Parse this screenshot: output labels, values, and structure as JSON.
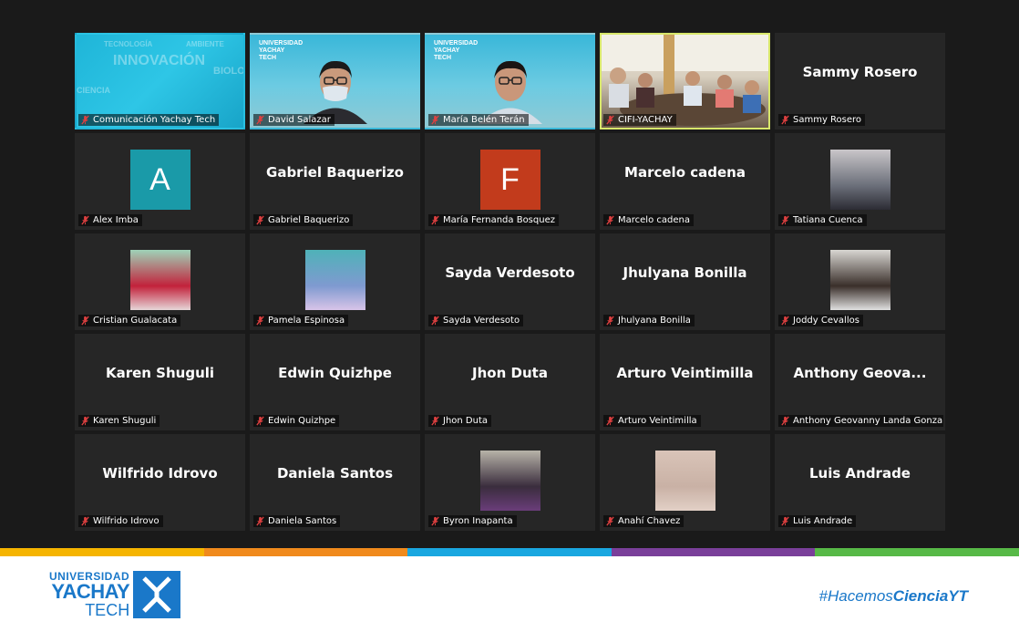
{
  "participants": [
    {
      "name": "Comunicación Yachay Tech",
      "display": "",
      "kind": "video-cyan",
      "overlay": [
        "INNOVACIÓN",
        "TECNOLOGÍA",
        "AMBIENTE",
        "CIENCIA",
        "BIOLO"
      ]
    },
    {
      "name": "David Salazar",
      "display": "",
      "kind": "video-building",
      "brand": "UNIVERSIDAD YACHAY TECH"
    },
    {
      "name": "María Belén Terán",
      "display": "",
      "kind": "video-building",
      "brand": "UNIVERSIDAD YACHAY TECH"
    },
    {
      "name": "CIFI-YACHAY",
      "display": "",
      "kind": "video-room",
      "active": true
    },
    {
      "name": "Sammy Rosero",
      "display": "Sammy Rosero",
      "kind": "name"
    },
    {
      "name": "Alex Imba",
      "display": "",
      "kind": "letter",
      "letter": "A",
      "color": "#1a9aa8"
    },
    {
      "name": "Gabriel Baquerizo",
      "display": "Gabriel Baquerizo",
      "kind": "name"
    },
    {
      "name": "María Fernanda Bosquez",
      "display": "",
      "kind": "letter",
      "letter": "F",
      "color": "#c23b1c"
    },
    {
      "name": "Marcelo cadena",
      "display": "Marcelo cadena",
      "kind": "name"
    },
    {
      "name": "Tatiana Cuenca",
      "display": "",
      "kind": "photo",
      "palette": [
        "#c9c6c9",
        "#6b6f7a",
        "#2c2c34"
      ]
    },
    {
      "name": "Cristian Gualacata",
      "display": "",
      "kind": "photo",
      "palette": [
        "#9fd3b8",
        "#c2223b",
        "#e6d6d8"
      ]
    },
    {
      "name": "Pamela Espinosa",
      "display": "",
      "kind": "photo",
      "palette": [
        "#4fb2b8",
        "#7f9ad0",
        "#d8c4e8"
      ]
    },
    {
      "name": "Sayda Verdesoto",
      "display": "Sayda Verdesoto",
      "kind": "name"
    },
    {
      "name": "Jhulyana Bonilla",
      "display": "Jhulyana Bonilla",
      "kind": "name"
    },
    {
      "name": "Joddy Cevallos",
      "display": "",
      "kind": "photo",
      "palette": [
        "#d8d6d2",
        "#3a2f2a",
        "#e0e0e0"
      ]
    },
    {
      "name": "Karen Shuguli",
      "display": "Karen Shuguli",
      "kind": "name"
    },
    {
      "name": "Edwin Quizhpe",
      "display": "Edwin Quizhpe",
      "kind": "name"
    },
    {
      "name": "Jhon Duta",
      "display": "Jhon Duta",
      "kind": "name"
    },
    {
      "name": "Arturo Veintimilla",
      "display": "Arturo Veintimilla",
      "kind": "name"
    },
    {
      "name": "Anthony Geovanny Landa Gonzalez",
      "display": "Anthony  Geova...",
      "kind": "name"
    },
    {
      "name": "Wilfrido Idrovo",
      "display": "Wilfrido Idrovo",
      "kind": "name"
    },
    {
      "name": "Daniela Santos",
      "display": "Daniela Santos",
      "kind": "name"
    },
    {
      "name": "Byron Inapanta",
      "display": "",
      "kind": "photo",
      "palette": [
        "#b7b3a8",
        "#3a2d3d",
        "#6a3d7a"
      ]
    },
    {
      "name": "Anahí Chavez",
      "display": "",
      "kind": "photo",
      "palette": [
        "#d9c4b8",
        "#c9b1a5",
        "#e2d0c6"
      ]
    },
    {
      "name": "Luis Andrade",
      "display": "Luis Andrade",
      "kind": "name"
    }
  ],
  "footer": {
    "logo": {
      "line1": "UNIVERSIDAD",
      "line2": "YACHAY",
      "line3": "TECH"
    },
    "hashtag_prefix": "#Hacemos",
    "hashtag_suffix": "CienciaYT",
    "stripe_colors": [
      "#f5b400",
      "#f08a1c",
      "#1aa7e0",
      "#7a3f9a",
      "#57b947"
    ]
  }
}
